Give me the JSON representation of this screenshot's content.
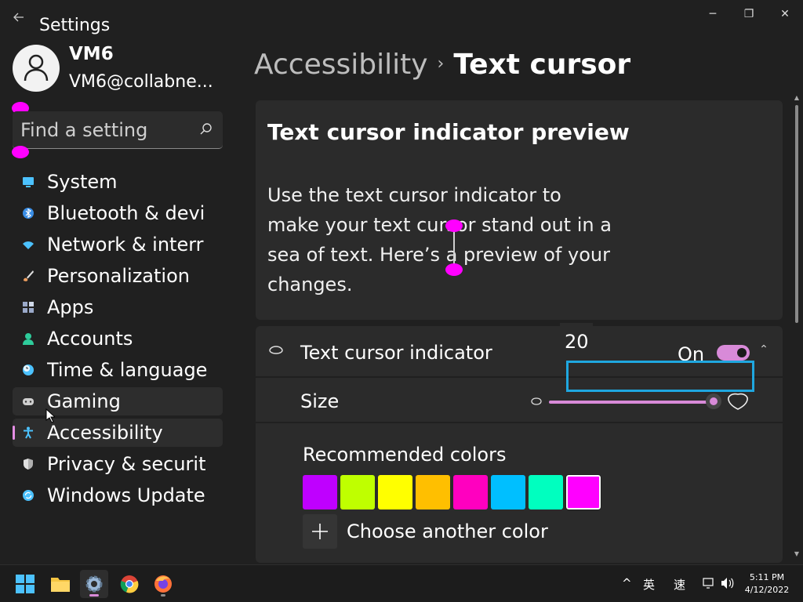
{
  "window": {
    "app_title": "Settings",
    "back_icon": "arrow-left-icon",
    "controls": {
      "minimize": "─",
      "maximize": "❐",
      "close": "✕"
    }
  },
  "user": {
    "name": "VM6",
    "email": "VM6@collabne..."
  },
  "search": {
    "placeholder": "Find a setting"
  },
  "nav": {
    "items": [
      {
        "label": "System",
        "icon": "monitor-icon",
        "color": "#4cc2ff"
      },
      {
        "label": "Bluetooth & devi",
        "icon": "bluetooth-icon",
        "color": "#3a8ee6"
      },
      {
        "label": "Network & interr",
        "icon": "wifi-icon",
        "color": "#4cc2ff"
      },
      {
        "label": "Personalization",
        "icon": "brush-icon",
        "color": "#f0a060"
      },
      {
        "label": "Apps",
        "icon": "apps-icon",
        "color": "#9aa9c9"
      },
      {
        "label": "Accounts",
        "icon": "person-icon",
        "color": "#2ecc9b"
      },
      {
        "label": "Time & language",
        "icon": "clock-globe-icon",
        "color": "#4cc2ff"
      },
      {
        "label": "Gaming",
        "icon": "gamepad-icon",
        "color": "#cccccc"
      },
      {
        "label": "Accessibility",
        "icon": "accessibility-icon",
        "color": "#4cc2ff"
      },
      {
        "label": "Privacy & securit",
        "icon": "shield-icon",
        "color": "#b0b0b0"
      },
      {
        "label": "Windows Update",
        "icon": "update-icon",
        "color": "#4cc2ff"
      }
    ],
    "hover_index": 7,
    "selected_index": 8
  },
  "breadcrumb": {
    "parent": "Accessibility",
    "separator": "›",
    "current": "Text cursor"
  },
  "preview": {
    "title": "Text cursor indicator preview",
    "line1": "Use the text cursor indicator to",
    "line2": "make your text cursor stand out in a",
    "line3": "sea of text. Here’s a preview of your",
    "line4": "changes."
  },
  "indicator": {
    "label": "Text cursor indicator",
    "toggle_state": "On"
  },
  "size": {
    "label": "Size",
    "value": "20",
    "slider_fraction": 1.0
  },
  "colors": {
    "label": "Recommended colors",
    "swatches": [
      "#bf00ff",
      "#bfff00",
      "#ffff00",
      "#ffbf00",
      "#ff00bf",
      "#00bfff",
      "#00ffbf",
      "#ff00ff"
    ],
    "selected_index": 7,
    "choose_label": "Choose another color",
    "indicator_color": "#ff00ff"
  },
  "tray": {
    "chevron": "^",
    "ime1": "英",
    "ime2": "速",
    "time": "5:11 PM",
    "date": "4/12/2022"
  }
}
